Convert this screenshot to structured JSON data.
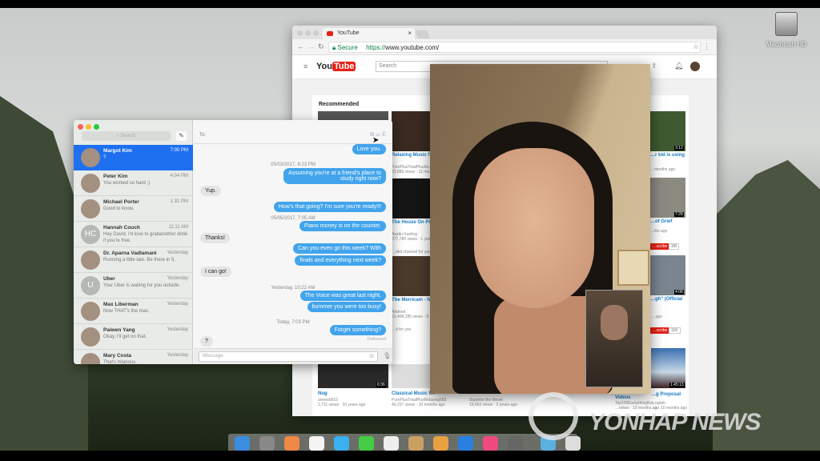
{
  "desktop": {
    "drive_label": "Macintosh HD"
  },
  "chrome": {
    "tab_title": "YouTube",
    "secure_label": "Secure",
    "url_scheme": "https://",
    "url_host": "www.youtube.com/",
    "youtube": {
      "logo_you": "You",
      "logo_tube": "Tube",
      "search_placeholder": "Search",
      "section_title": "Recommended",
      "videos": [
        {
          "title": "Relaxing Music f… Times",
          "channel": "PurePlusTotalPlusRe…",
          "meta": "21,889 views · 11 mo…"
        },
        {
          "title": "The House On Pi… Official Trailer",
          "channel": "Austin Keeling",
          "meta": "277,789 views · 1 yea…"
        },
        {
          "title": "The Merricam - N… \"Steadicam\" DIY",
          "channel": "Android",
          "meta": "21,408,285 views · 9 …"
        },
        {
          "title": "Nug",
          "channel": "aneesh815",
          "meta": "1,711 views · 10 years ago",
          "duration": "6:36"
        },
        {
          "title": "Classical Music f…",
          "channel": "PurePlusTotalPlusRelaxing583",
          "meta": "40,237 views · 10 months ago"
        },
        {
          "title": "",
          "channel": "Superior the Movie",
          "meta": "19,662 views · 2 years ago"
        },
        {
          "title": "…r kid is using",
          "meta": "…months ago",
          "duration": "3:12"
        },
        {
          "title": "…of Grief",
          "meta": "…ths ago",
          "duration": "7:28"
        },
        {
          "title": "…gh\" (Official",
          "meta": "… ago",
          "duration": "4:08"
        },
        {
          "title": "Videos",
          "channel": "Top100EverythingBsh",
          "meta": "…views · 10 months ago"
        },
        {
          "title": "…g Proposal",
          "channel": "…nglish",
          "meta": "…s · 10 months ago",
          "duration": "1:45:13"
        }
      ],
      "shelf_labels": [
        "…ded channel for you",
        "…d for you"
      ],
      "subscribe_label": "…scribe",
      "subscribe_counts": [
        "1M",
        "11K"
      ]
    }
  },
  "messages": {
    "search_placeholder": "Search",
    "conversations": [
      {
        "name": "Margot Kim",
        "time": "7:00 PM",
        "preview": "?",
        "selected": true
      },
      {
        "name": "Peter Kim",
        "time": "4:04 PM",
        "preview": "You worked so hard ;)"
      },
      {
        "name": "Michael Porter",
        "time": "1:31 PM",
        "preview": "Good to know."
      },
      {
        "name": "Hannah Couch",
        "time": "11:11 AM",
        "preview": "Hey David, I'd love to grabanother drink if you're free.",
        "initials": "HC"
      },
      {
        "name": "Dr. Aparna Vadlamani",
        "time": "Yesterday",
        "preview": "Running a little late. Be there in 5."
      },
      {
        "name": "Uber",
        "time": "Yesterday",
        "preview": "Your Uber is waiting for you outside.",
        "initials": "U"
      },
      {
        "name": "Max Liberman",
        "time": "Yesterday",
        "preview": "Now THAT's the max."
      },
      {
        "name": "Paiwen Yang",
        "time": "Yesterday",
        "preview": "Okay, I'll get on that."
      },
      {
        "name": "Mary Costa",
        "time": "Yesterday",
        "preview": "That's hilarious."
      }
    ],
    "to_label": "To:",
    "thread": [
      {
        "from": "me",
        "text": "Love you."
      },
      {
        "timestamp": "05/03/2017, 8:23 PM"
      },
      {
        "from": "me",
        "text": "Assuming you're at a friend's place to\nstudy right now?"
      },
      {
        "from": "them",
        "text": "Yup."
      },
      {
        "from": "me",
        "text": "How's that going? I'm sure you're ready!!!"
      },
      {
        "timestamp": "05/05/2017, 7:05 AM"
      },
      {
        "from": "me",
        "text": "Piano money is on the counter."
      },
      {
        "from": "them",
        "text": "Thanks!"
      },
      {
        "from": "me",
        "text": "Can you even go this week? With"
      },
      {
        "from": "me",
        "text": "finals and everything next week?"
      },
      {
        "from": "them",
        "text": "I can go!"
      },
      {
        "timestamp": "Yesterday, 10:22 AM"
      },
      {
        "from": "me",
        "text": "The Voice was great last night,"
      },
      {
        "from": "me",
        "text": "bummer you were too busy!"
      },
      {
        "timestamp": "Today, 7:03 PM"
      },
      {
        "from": "me",
        "text": "Forget something?"
      },
      {
        "from": "them",
        "text": "?"
      }
    ],
    "delivered": "Delivered",
    "input_placeholder": "iMessage"
  },
  "watermark": {
    "text": "YONHAP NEWS"
  },
  "colors": {
    "selected_row": "#1e70f0",
    "sent_bubble": "#41a4ec",
    "received_bubble": "#e4e4e4",
    "youtube_red": "#e62117",
    "link_blue": "#167ac6"
  }
}
